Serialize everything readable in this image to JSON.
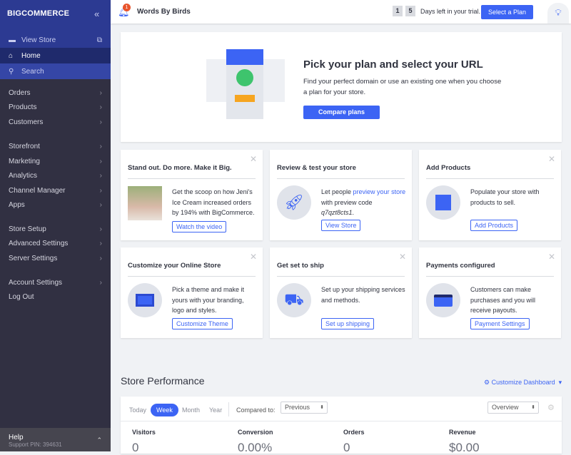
{
  "sidebar": {
    "logo": "BIGCOMMERCE",
    "view_store": "View Store",
    "home": "Home",
    "search": "Search",
    "menu": [
      "Orders",
      "Products",
      "Customers",
      "Storefront",
      "Marketing",
      "Analytics",
      "Channel Manager",
      "Apps",
      "Store Setup",
      "Advanced Settings",
      "Server Settings",
      "Account Settings",
      "Log Out"
    ],
    "help": "Help",
    "support_pin": "Support PIN: 394631"
  },
  "topbar": {
    "notifications": "1",
    "store_name": "Words By Birds",
    "days": [
      "1",
      "5"
    ],
    "trial_text": "Days left in your trial.",
    "select_plan": "Select a Plan"
  },
  "hero": {
    "title": "Pick your plan and select your URL",
    "text": "Find your perfect domain or use an existing one when you choose a plan for your store.",
    "button": "Compare plans"
  },
  "tiles": [
    {
      "title": "Stand out. Do more. Make it Big.",
      "text": "Get the scoop on how Jeni's Ice Cream increased orders by 194% with BigCommerce.",
      "button": "Watch the video"
    },
    {
      "title": "Review & test your store",
      "text_pre": "Let people ",
      "link": "preview your store",
      "text_post": " with preview code ",
      "code": "q7qzt8cts1",
      "text_end": ".",
      "button": "View Store"
    },
    {
      "title": "Add Products",
      "text": "Populate your store with products to sell.",
      "button": "Add Products"
    },
    {
      "title": "Customize your Online Store",
      "text": "Pick a theme and make it yours with your branding, logo and styles.",
      "button": "Customize Theme"
    },
    {
      "title": "Get set to ship",
      "text": "Set up your shipping services and methods.",
      "button": "Set up shipping"
    },
    {
      "title": "Payments configured",
      "text": "Customers can make purchases and you will receive payouts.",
      "button": "Payment Settings"
    }
  ],
  "performance": {
    "title": "Store Performance",
    "customize": "Customize Dashboard",
    "ranges": [
      "Today",
      "Week",
      "Month",
      "Year"
    ],
    "active_range": "Week",
    "compared_label": "Compared to:",
    "compared_value": "Previous",
    "view": "Overview",
    "metrics": [
      {
        "label": "Visitors",
        "value": "0"
      },
      {
        "label": "Conversion",
        "value": "0.00%"
      },
      {
        "label": "Orders",
        "value": "0"
      },
      {
        "label": "Revenue",
        "value": "$0.00"
      }
    ]
  },
  "colors": {
    "accent": "#3c64f4",
    "sidebar_top": "#2c3a92",
    "sidebar": "#313042"
  }
}
